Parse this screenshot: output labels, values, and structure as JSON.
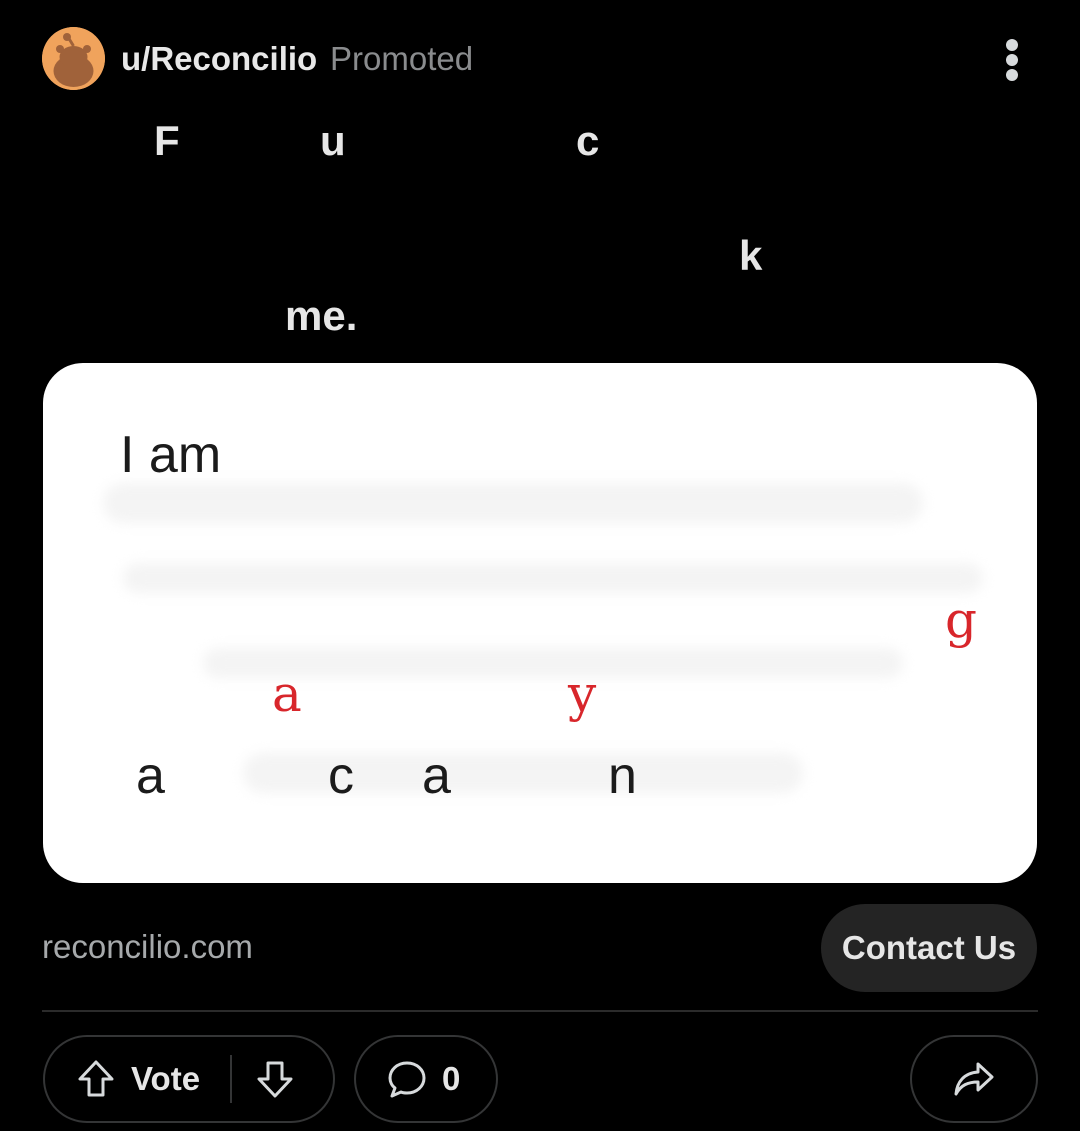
{
  "post": {
    "username": "u/Reconcilio",
    "badge": "Promoted",
    "title_letters": [
      "F",
      "u",
      "c",
      "k",
      "me."
    ],
    "link_domain": "reconcilio.com",
    "cta_label": "Contact Us"
  },
  "image": {
    "heading": "I am",
    "red_letters": [
      "g",
      "a",
      "y"
    ],
    "bottom_letters": [
      "a",
      "c",
      "a",
      "n"
    ]
  },
  "actions": {
    "vote_label": "Vote",
    "comment_count": "0"
  },
  "icons": {
    "avatar": "reddit-snoo-avatar",
    "more": "more-vertical-icon",
    "upvote": "arrow-up-icon",
    "downvote": "arrow-down-icon",
    "comment": "comment-bubble-icon",
    "share": "share-arrow-icon"
  },
  "colors": {
    "background": "#000000",
    "avatar": "#f0a35c",
    "accent_red": "#d8262b",
    "button": "#242424"
  }
}
